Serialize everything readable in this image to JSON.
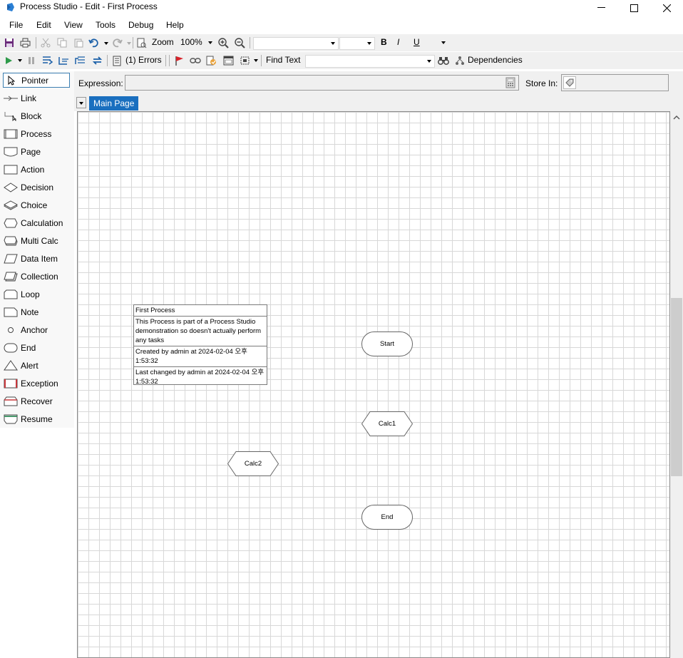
{
  "window": {
    "title": "Process Studio  - Edit - First Process"
  },
  "menu": {
    "file": "File",
    "edit": "Edit",
    "view": "View",
    "tools": "Tools",
    "debug": "Debug",
    "help": "Help"
  },
  "toolbar1": {
    "zoom_label": "Zoom",
    "zoom_value": "100%",
    "bold": "B",
    "italic": "I",
    "underline": "U"
  },
  "toolbar2": {
    "errors": "(1) Errors",
    "find_text": "Find Text",
    "dependencies": "Dependencies"
  },
  "palette": {
    "items": [
      {
        "label": "Pointer"
      },
      {
        "label": "Link"
      },
      {
        "label": "Block"
      },
      {
        "label": "Process"
      },
      {
        "label": "Page"
      },
      {
        "label": "Action"
      },
      {
        "label": "Decision"
      },
      {
        "label": "Choice"
      },
      {
        "label": "Calculation"
      },
      {
        "label": "Multi Calc"
      },
      {
        "label": "Data Item"
      },
      {
        "label": "Collection"
      },
      {
        "label": "Loop"
      },
      {
        "label": "Note"
      },
      {
        "label": "Anchor"
      },
      {
        "label": "End"
      },
      {
        "label": "Alert"
      },
      {
        "label": "Exception"
      },
      {
        "label": "Recover"
      },
      {
        "label": "Resume"
      }
    ]
  },
  "expression": {
    "label": "Expression:",
    "store_in_label": "Store In:"
  },
  "tabs": {
    "main_page": "Main Page"
  },
  "diagram": {
    "note": {
      "title": "First Process",
      "description": "This Process is part of a Process Studio demonstration so doesn't actually perform any tasks",
      "created": "Created  by  admin  at  2024-02-04 오후 1:53:32",
      "changed": "Last changed by admin at 2024-02-04 오후 1:53:32"
    },
    "start": "Start",
    "calc1": "Calc1",
    "calc2": "Calc2",
    "end": "End"
  },
  "colors": {
    "accent": "#1a6fbf",
    "exception": "#c8383c",
    "recover": "#c8383c",
    "resume": "#2e8b57"
  }
}
